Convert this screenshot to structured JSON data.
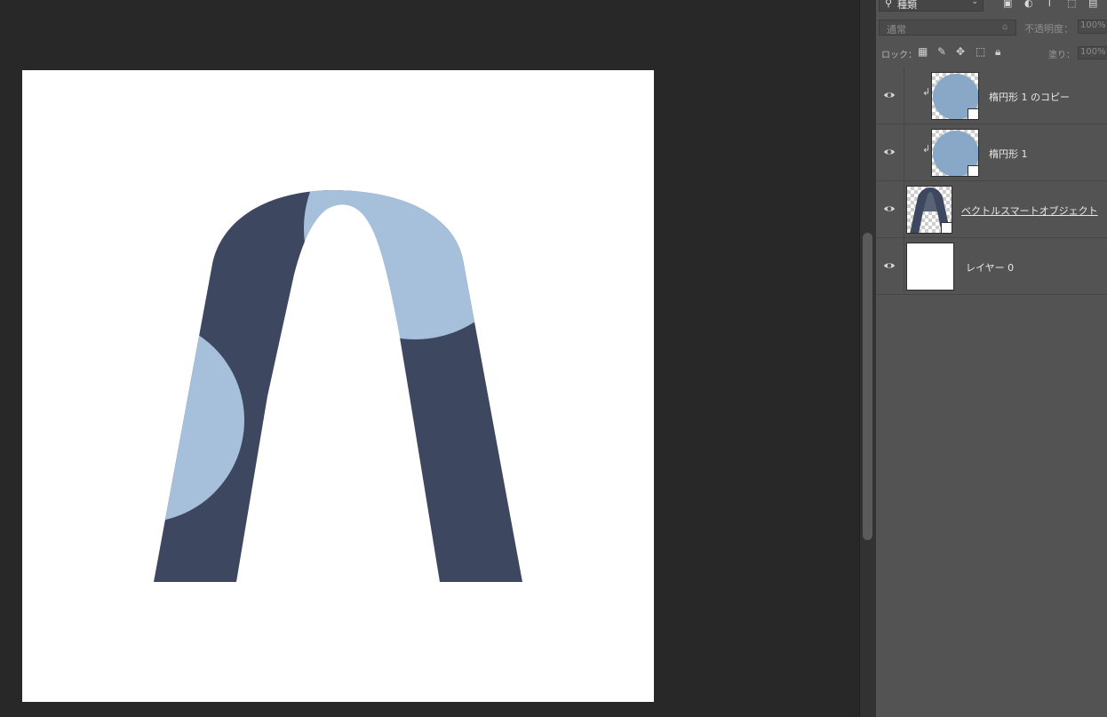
{
  "colors": {
    "workspace": "#282828",
    "panel": "#535353",
    "letter_dark": "#3d4860",
    "letter_light": "#a6bfdb",
    "ellipse_thumb": "#89a7c6"
  },
  "layers_panel": {
    "filter": {
      "icon": "search-icon",
      "label": "種類"
    },
    "blend_mode": "通常",
    "opacity_label": "不透明度：",
    "opacity_value": "100%",
    "lock_label": "ロック：",
    "fill_label": "塗り：",
    "fill_value": "100%"
  },
  "layers": [
    {
      "name": "楕円形 1 のコピー",
      "clipped": true,
      "type": "shape",
      "visible": true
    },
    {
      "name": "楕円形 1",
      "clipped": true,
      "type": "shape",
      "visible": true
    },
    {
      "name": "ベクトルスマートオブジェクト",
      "clipped": false,
      "type": "smart-object",
      "visible": true
    },
    {
      "name": "レイヤー 0",
      "clipped": false,
      "type": "pixel",
      "visible": true
    }
  ]
}
